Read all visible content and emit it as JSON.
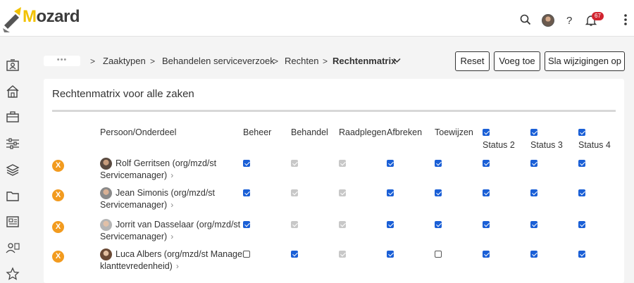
{
  "app": {
    "logo_text_a": "M",
    "logo_text_b": "ozard",
    "notifications_count": "67"
  },
  "breadcrumb": {
    "overflow": "•••",
    "items": [
      "Zaaktypen",
      "Behandelen serviceverzoek",
      "Rechten"
    ],
    "current": "Rechtenmatrix",
    "separator": ">"
  },
  "actions": {
    "reset": "Reset",
    "add": "Voeg toe",
    "save": "Sla wijzigingen op"
  },
  "card": {
    "title": "Rechtenmatrix voor alle zaken"
  },
  "table": {
    "col_person": "Persoon/Onderdeel",
    "columns": [
      "Beheer",
      "Behandel",
      "Raadplegen",
      "Afbreken",
      "Toewijzen"
    ],
    "status_columns": [
      "Status 2",
      "Status 3",
      "Status 4"
    ],
    "status_header_checked": [
      true,
      true,
      true
    ],
    "remove_label": "X",
    "rows": [
      {
        "name": "Rolf Gerritsen (org/mzd/st",
        "role": "Servicemanager)",
        "values": [
          "on",
          "dis",
          "dis",
          "on",
          "on",
          "on",
          "on",
          "on"
        ]
      },
      {
        "name": "Jean Simonis (org/mzd/st",
        "role": "Servicemanager)",
        "values": [
          "on",
          "dis",
          "dis",
          "on",
          "on",
          "on",
          "on",
          "on"
        ]
      },
      {
        "name": "Jorrit van Dasselaar (org/mzd/st",
        "role": "Servicemanager)",
        "values": [
          "on",
          "dis",
          "dis",
          "on",
          "on",
          "on",
          "on",
          "on"
        ]
      },
      {
        "name": "Luca Albers (org/mzd/st Manager",
        "role": "klanttevredenheid)",
        "values": [
          "off",
          "on",
          "dis",
          "on",
          "off",
          "on",
          "on",
          "on"
        ]
      }
    ]
  },
  "colors": {
    "accent": "#1a5fd6",
    "remove": "#f29b1f",
    "badge": "#d1242f",
    "logo_yellow": "#f2c200"
  },
  "icons": {
    "top": [
      "search-icon",
      "user-avatar",
      "help-icon",
      "bell-icon",
      "more-vertical-icon"
    ],
    "sidebar": [
      "contact-card-icon",
      "home-icon",
      "briefcase-icon",
      "sliders-icon",
      "layers-icon",
      "folder-icon",
      "newspaper-icon",
      "user-group-icon",
      "star-icon"
    ]
  }
}
